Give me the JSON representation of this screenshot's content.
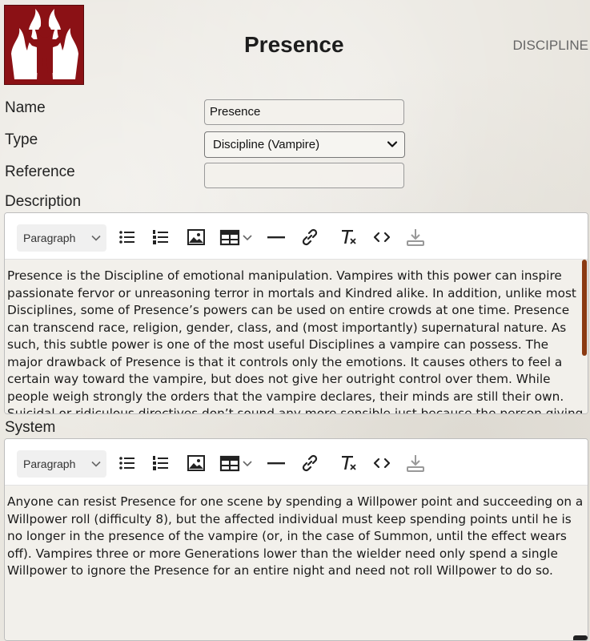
{
  "header": {
    "title": "Presence",
    "doc_type": "DISCIPLINE",
    "logo_icon": "presence-emblem-icon",
    "logo_color": "#8b1115"
  },
  "form": {
    "name": {
      "label": "Name",
      "value": "Presence"
    },
    "type": {
      "label": "Type",
      "value": "Discipline (Vampire)"
    },
    "reference": {
      "label": "Reference",
      "value": ""
    }
  },
  "toolbar": {
    "format_label": "Paragraph",
    "icons": [
      "bullet-list-icon",
      "numbered-list-icon",
      "image-icon",
      "table-icon",
      "horizontal-rule-icon",
      "link-icon",
      "clear-format-icon",
      "code-icon",
      "download-icon"
    ]
  },
  "description": {
    "label": "Description",
    "text": "Presence is the Discipline of emotional manipulation. Vampires with this power can inspire passionate fervor or unreasoning terror in mortals and Kindred alike. In addition, unlike most Disciplines, some of Presence’s powers can be used on entire crowds at one time. Presence can transcend race, religion, gender, class, and (most importantly) supernatural nature. As such, this subtle power is one of the most useful Disciplines a vampire can possess. The major drawback of Presence is that it controls only the emotions. It causes others to feel a certain way toward the vampire, but does not give her outright control over them. While people weigh strongly the orders that the vampire declares, their minds are still their own. Suicidal or ridiculous directives don’t sound any more sensible just because the person giving them is"
  },
  "system": {
    "label": "System",
    "text": "Anyone can resist Presence for one scene by spending a Willpower point and succeeding on a Willpower roll (difficulty 8), but the affected individual must keep spending points until he is no longer in the presence of the vampire (or, in the case of Summon, until the effect wears off). Vampires three or more Generations lower than the wielder need only spend a single Willpower to ignore the Presence for an entire night and need not roll Willpower to do so."
  },
  "colors": {
    "accent": "#8a3a12",
    "background": "#e9e6df"
  }
}
